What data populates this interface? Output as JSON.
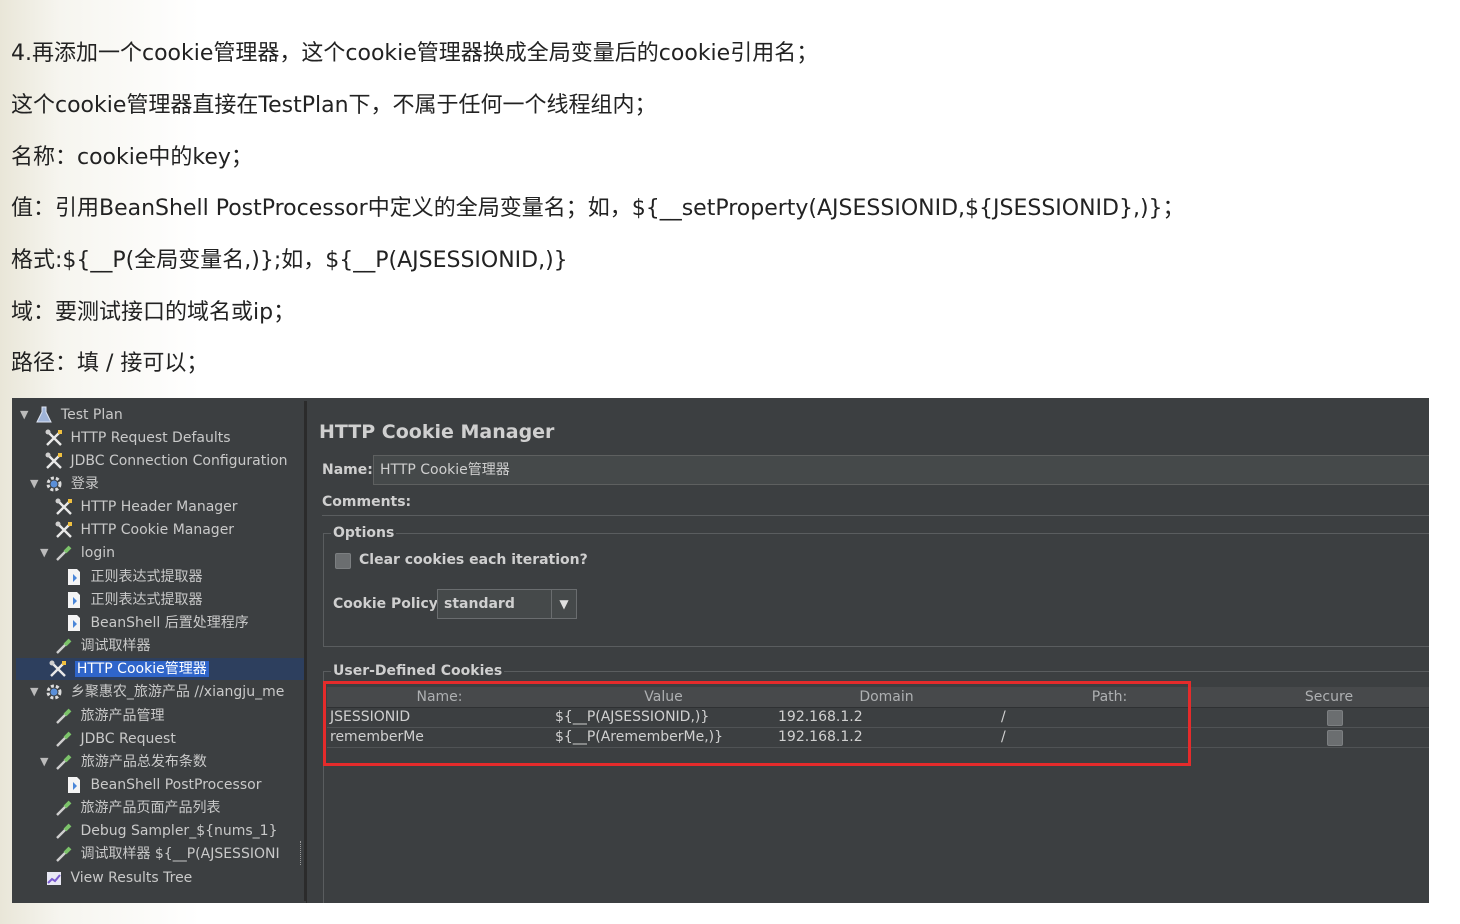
{
  "doc": {
    "lines": [
      " 4.再添加一个cookie管理器，这个cookie管理器换成全局变量后的cookie引用名；",
      "这个cookie管理器直接在TestPlan下，不属于任何一个线程组内；",
      "名称：cookie中的key；",
      "值：引用BeanShell PostProcessor中定义的全局变量名；如，${__setProperty(AJSESSIONID,${JSESSIONID},)}；",
      "格式:${__P(全局变量名,)};如，${__P(AJSESSIONID,)}",
      "域：要测试接口的域名或ip；",
      "路径：填 / 接可以；"
    ]
  },
  "tree": {
    "nodes": [
      {
        "label": "Test Plan",
        "icon": "flask-icon",
        "expanded": true
      },
      {
        "label": "HTTP Request Defaults",
        "icon": "wrench-icon"
      },
      {
        "label": "JDBC Connection Configuration",
        "icon": "wrench-icon"
      },
      {
        "label": "登录",
        "icon": "gear-icon",
        "expanded": true
      },
      {
        "label": "HTTP Header Manager",
        "icon": "wrench-icon"
      },
      {
        "label": "HTTP Cookie Manager",
        "icon": "wrench-icon"
      },
      {
        "label": "login",
        "icon": "pipette-icon",
        "expanded": true
      },
      {
        "label": "正则表达式提取器",
        "icon": "document-icon"
      },
      {
        "label": "正则表达式提取器",
        "icon": "document-icon"
      },
      {
        "label": "BeanShell 后置处理程序",
        "icon": "document-icon"
      },
      {
        "label": "调试取样器",
        "icon": "pipette-icon"
      },
      {
        "label": "HTTP Cookie管理器",
        "icon": "wrench-icon",
        "selected": true
      },
      {
        "label": "乡聚惠农_旅游产品 //xiangju_me",
        "icon": "gear-icon",
        "expanded": true
      },
      {
        "label": "旅游产品管理",
        "icon": "pipette-icon"
      },
      {
        "label": "JDBC Request",
        "icon": "pipette-icon"
      },
      {
        "label": "旅游产品总发布条数",
        "icon": "pipette-icon",
        "expanded": true
      },
      {
        "label": "BeanShell PostProcessor",
        "icon": "document-icon"
      },
      {
        "label": "旅游产品页面产品列表",
        "icon": "pipette-icon"
      },
      {
        "label": "Debug Sampler_${nums_1}",
        "icon": "pipette-icon"
      },
      {
        "label": "调试取样器 ${__P(AJSESSIONI",
        "icon": "pipette-icon"
      },
      {
        "label": "View Results Tree",
        "icon": "chart-icon"
      }
    ]
  },
  "panel": {
    "title": "HTTP Cookie Manager",
    "name_label": "Name:",
    "name_value": "HTTP Cookie管理器",
    "comments_label": "Comments:",
    "options_title": "Options",
    "clear_cookies_label": "Clear cookies each iteration?",
    "policy_label": "Cookie Policy:",
    "policy_value": "standard",
    "cookies_title": "User-Defined Cookies",
    "table": {
      "columns": [
        "Name:",
        "Value",
        "Domain",
        "Path:",
        "Secure"
      ],
      "rows": [
        {
          "name": "JSESSIONID",
          "value": "${__P(AJSESSIONID,)}",
          "domain": "192.168.1.2",
          "path": "/",
          "secure": false
        },
        {
          "name": "rememberMe",
          "value": "${__P(ArememberMe,)}",
          "domain": "192.168.1.2",
          "path": "/",
          "secure": false
        }
      ]
    }
  },
  "colors": {
    "highlight": "#e52b2b",
    "selection": "#2f65ca",
    "background": "#3c3f41"
  }
}
